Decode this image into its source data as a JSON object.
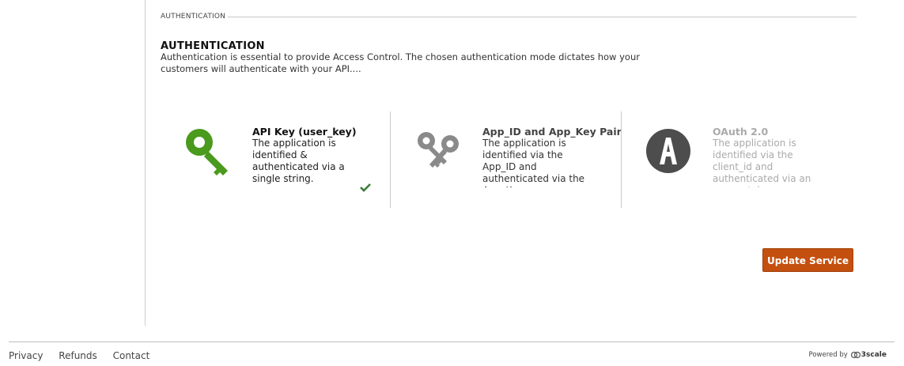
{
  "fieldset": {
    "legend": "AUTHENTICATION"
  },
  "section": {
    "title": "AUTHENTICATION",
    "description": "Authentication is essential to provide Access Control. The chosen authentication mode dictates how your customers will authenticate with your API...."
  },
  "auth_options": [
    {
      "title": "API Key (user_key)",
      "description": "The application is identified & authenticated via a single string.",
      "icon": "green-key-icon",
      "selected": true
    },
    {
      "title": "App_ID and App_Key Pair",
      "description": "The application is identified via the App_ID and authenticated via the App_Key.",
      "icon": "double-key-icon",
      "selected": false
    },
    {
      "title": "OAuth 2.0",
      "description": "The application is identified via the client_id and authenticated via an access token.",
      "icon": "oauth-icon",
      "selected": false,
      "disabled": true
    }
  ],
  "actions": {
    "update_label": "Update Service"
  },
  "footer": {
    "links": [
      "Privacy",
      "Refunds",
      "Contact"
    ],
    "powered_by": "Powered by",
    "brand": "3scale"
  },
  "colors": {
    "accent_button": "#c4500f",
    "key_green": "#4a9a1d",
    "check_green": "#3a7d3a"
  }
}
